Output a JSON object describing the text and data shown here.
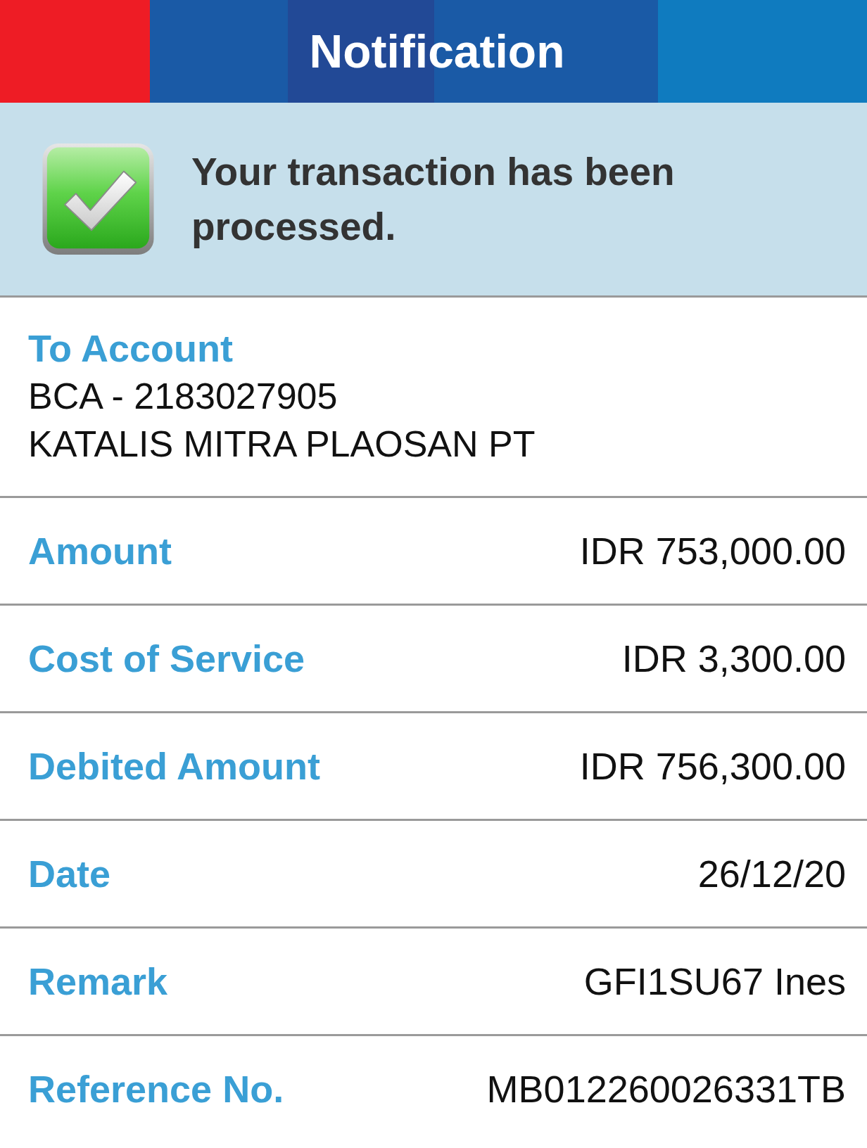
{
  "header": {
    "title": "Notification"
  },
  "status": {
    "kind": "success",
    "message": "Your transaction has been processed."
  },
  "recipient": {
    "label": "To Account",
    "lines": [
      "BCA - 2183027905",
      "KATALIS MITRA PLAOSAN PT"
    ]
  },
  "details": [
    {
      "label": "Amount",
      "value": "IDR 753,000.00"
    },
    {
      "label": "Cost of Service",
      "value": "IDR 3,300.00"
    },
    {
      "label": "Debited Amount",
      "value": "IDR 756,300.00"
    },
    {
      "label": "Date",
      "value": "26/12/20"
    },
    {
      "label": "Remark",
      "value": "GFI1SU67 Ines"
    },
    {
      "label": "Reference No.",
      "value": "MB012260026331TB"
    }
  ]
}
